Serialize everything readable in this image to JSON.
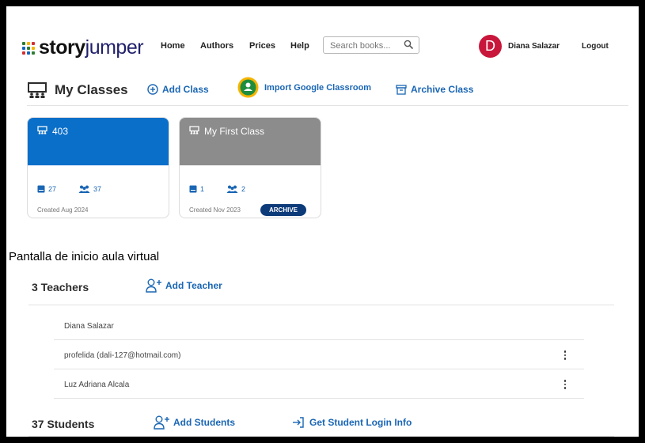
{
  "header": {
    "logo_story": "story",
    "logo_jumper": "jumper",
    "nav": [
      "Home",
      "Authors",
      "Prices",
      "Help"
    ],
    "search_placeholder": "Search books...",
    "avatar_initial": "D",
    "user_name": "Diana Salazar",
    "logout_label": "Logout"
  },
  "classes": {
    "title": "My Classes",
    "add_class": "Add Class",
    "import_google": "Import Google Classroom",
    "archive_class": "Archive Class",
    "cards": [
      {
        "name": "403",
        "books": "27",
        "students": "37",
        "created": "Created Aug 2024",
        "color": "#0a6fc9"
      },
      {
        "name": "My First Class",
        "books": "1",
        "students": "2",
        "created": "Created Nov 2023",
        "color": "#8c8c8c",
        "badge": "ARCHIVE"
      }
    ]
  },
  "caption": "Pantalla de inicio aula virtual",
  "teachers": {
    "title": "3 Teachers",
    "add_label": "Add Teacher",
    "list": [
      "Diana Salazar",
      "profelida (dali-127@hotmail.com)",
      "Luz Adriana Alcala"
    ]
  },
  "students": {
    "title": "37 Students",
    "add_label": "Add Students",
    "login_info": "Get Student Login Info"
  },
  "colors": {
    "accent": "#1a66b4",
    "avatar": "#c8173b",
    "badge": "#0d3a79",
    "google_green": "#1e8e3e"
  }
}
